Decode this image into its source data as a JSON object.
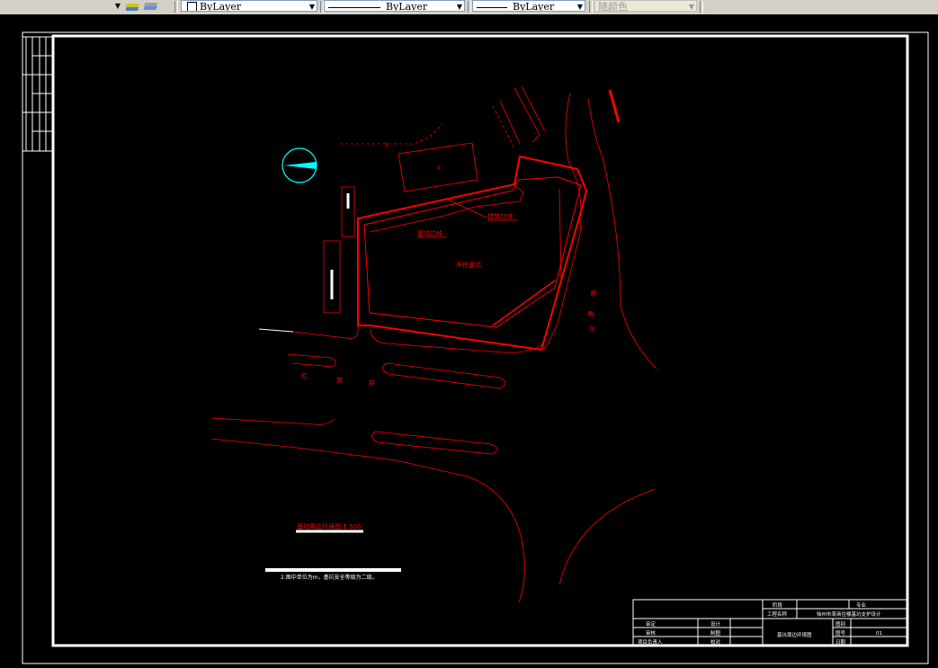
{
  "toolbar": {
    "layer_color_value": "ByLayer",
    "linetype_value": "ByLayer",
    "lineweight_value": "ByLayer",
    "plot_style_value": "随颜色"
  },
  "drawing": {
    "labels": {
      "building_line": "建筑红线",
      "foundation_line": "基坑边线",
      "excavation_area": "开挖基坑",
      "road_west_chars": [
        "红",
        "旗",
        "路"
      ],
      "road_east_chars": [
        "建",
        "设",
        "路"
      ],
      "block_label": "楼"
    },
    "drawing_title": "基坑周边环境图 1:500",
    "note": "2.图中单位为m，基坑安全等级为二级。",
    "title_block": {
      "r1": {
        "label": "阶段",
        "value": "专业"
      },
      "r2": {
        "label": "工程名称",
        "value": "徐州市某商住楼基坑支护设计"
      },
      "r3": [
        "审定",
        "设计",
        "图别"
      ],
      "r4": [
        "审核",
        "制图",
        "图号",
        "01"
      ],
      "r5": [
        "项目负责人",
        "校对",
        "日期"
      ],
      "sheet_title": "基坑周边环境图"
    },
    "colors": {
      "red": "#ff0000",
      "cyan": "#00ffff",
      "white": "#ffffff",
      "yellow": "#ffff00"
    }
  }
}
